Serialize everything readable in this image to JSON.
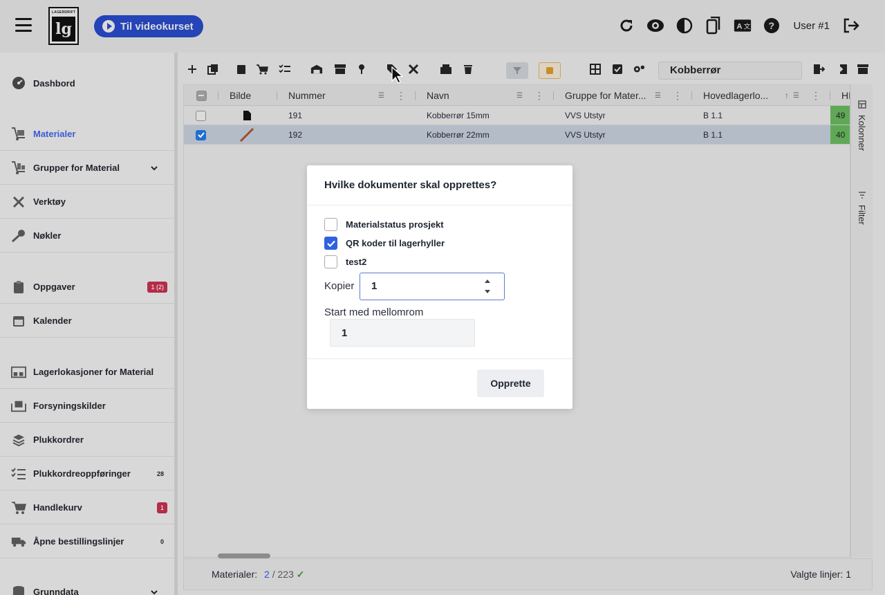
{
  "header": {
    "logo_text": "LAGERDRIFT",
    "logo_mark": "lg",
    "video_button": "Til videokurset",
    "user": "User #1"
  },
  "sidebar": {
    "items": [
      {
        "label": "Dashbord",
        "icon": "dashboard-icon"
      },
      {
        "label": "Materialer",
        "icon": "dolly-icon",
        "active": true
      },
      {
        "label": "Grupper for Material",
        "icon": "dolly-group-icon"
      },
      {
        "label": "Verktøy",
        "icon": "tools-icon"
      },
      {
        "label": "Nøkler",
        "icon": "key-icon"
      },
      {
        "label": "Oppgaver",
        "icon": "clipboard-icon",
        "badge": "1 (2)"
      },
      {
        "label": "Kalender",
        "icon": "calendar-icon"
      },
      {
        "label": "Lagerlokasjoner for Material",
        "icon": "warehouse-icon"
      },
      {
        "label": "Forsyningskilder",
        "icon": "pallet-icon"
      },
      {
        "label": "Plukkordrer",
        "icon": "layers-icon"
      },
      {
        "label": "Plukkordreoppføringer",
        "icon": "list-check-icon",
        "badge": "28"
      },
      {
        "label": "Handlekurv",
        "icon": "cart-icon",
        "badge": "1"
      },
      {
        "label": "Åpne bestillingslinjer",
        "icon": "truck-icon",
        "badge": "0"
      },
      {
        "label": "Grunndata",
        "icon": "database-icon"
      }
    ]
  },
  "toolbar": {
    "search_value": "Kobberrør"
  },
  "grid": {
    "columns": [
      "Bilde",
      "Nummer",
      "Navn",
      "Gruppe for Mater...",
      "Hovedlagerlo...",
      "HL"
    ],
    "rows": [
      {
        "nummer": "191",
        "navn": "Kobberrør 15mm",
        "gruppe": "VVS Utstyr",
        "lager": "B 1.1",
        "hl": "49",
        "selected": false
      },
      {
        "nummer": "192",
        "navn": "Kobberrør 22mm",
        "gruppe": "VVS Utstyr",
        "lager": "B 1.1",
        "hl": "40",
        "selected": true
      }
    ],
    "side_tabs": [
      "Kolonner",
      "Filter"
    ]
  },
  "footer": {
    "label": "Materialer:",
    "count": "2",
    "total": "/ 223",
    "selected": "Valgte linjer: 1"
  },
  "dialog": {
    "title": "Hvilke dokumenter skal opprettes?",
    "options": [
      {
        "label": "Materialstatus prosjekt",
        "checked": false
      },
      {
        "label": "QR koder til lagerhyller",
        "checked": true
      },
      {
        "label": "test2",
        "checked": false
      }
    ],
    "copies_label": "Kopier",
    "copies_value": "1",
    "gap_label": "Start med mellomrom",
    "gap_value": "1",
    "submit": "Opprette"
  }
}
